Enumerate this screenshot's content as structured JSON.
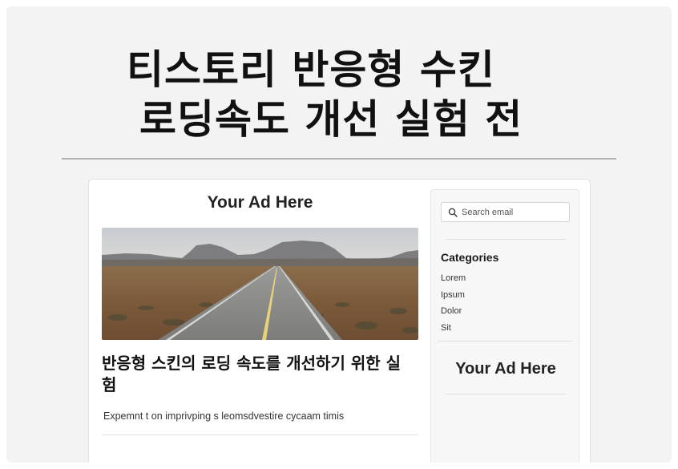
{
  "hero": {
    "title_line1": "티스토리 반응형 수킨",
    "title_line2": "로딩속도 개선 실험 전"
  },
  "main": {
    "ad_label": "Your Ad Here",
    "image_icon": "desert-road-photo",
    "post_title": "반응형 스킨의 로딩 속도를 개선하기 위한 실험",
    "post_excerpt": "Expemnt t on imprivping s leomsdvestire cycaam timis"
  },
  "sidebar": {
    "search": {
      "placeholder": "Search email",
      "icon": "search-icon"
    },
    "categories_title": "Categories",
    "categories": [
      "Lorem",
      "Ipsum",
      "Dolor",
      "Sit"
    ],
    "ad_label": "Your Ad Here"
  }
}
